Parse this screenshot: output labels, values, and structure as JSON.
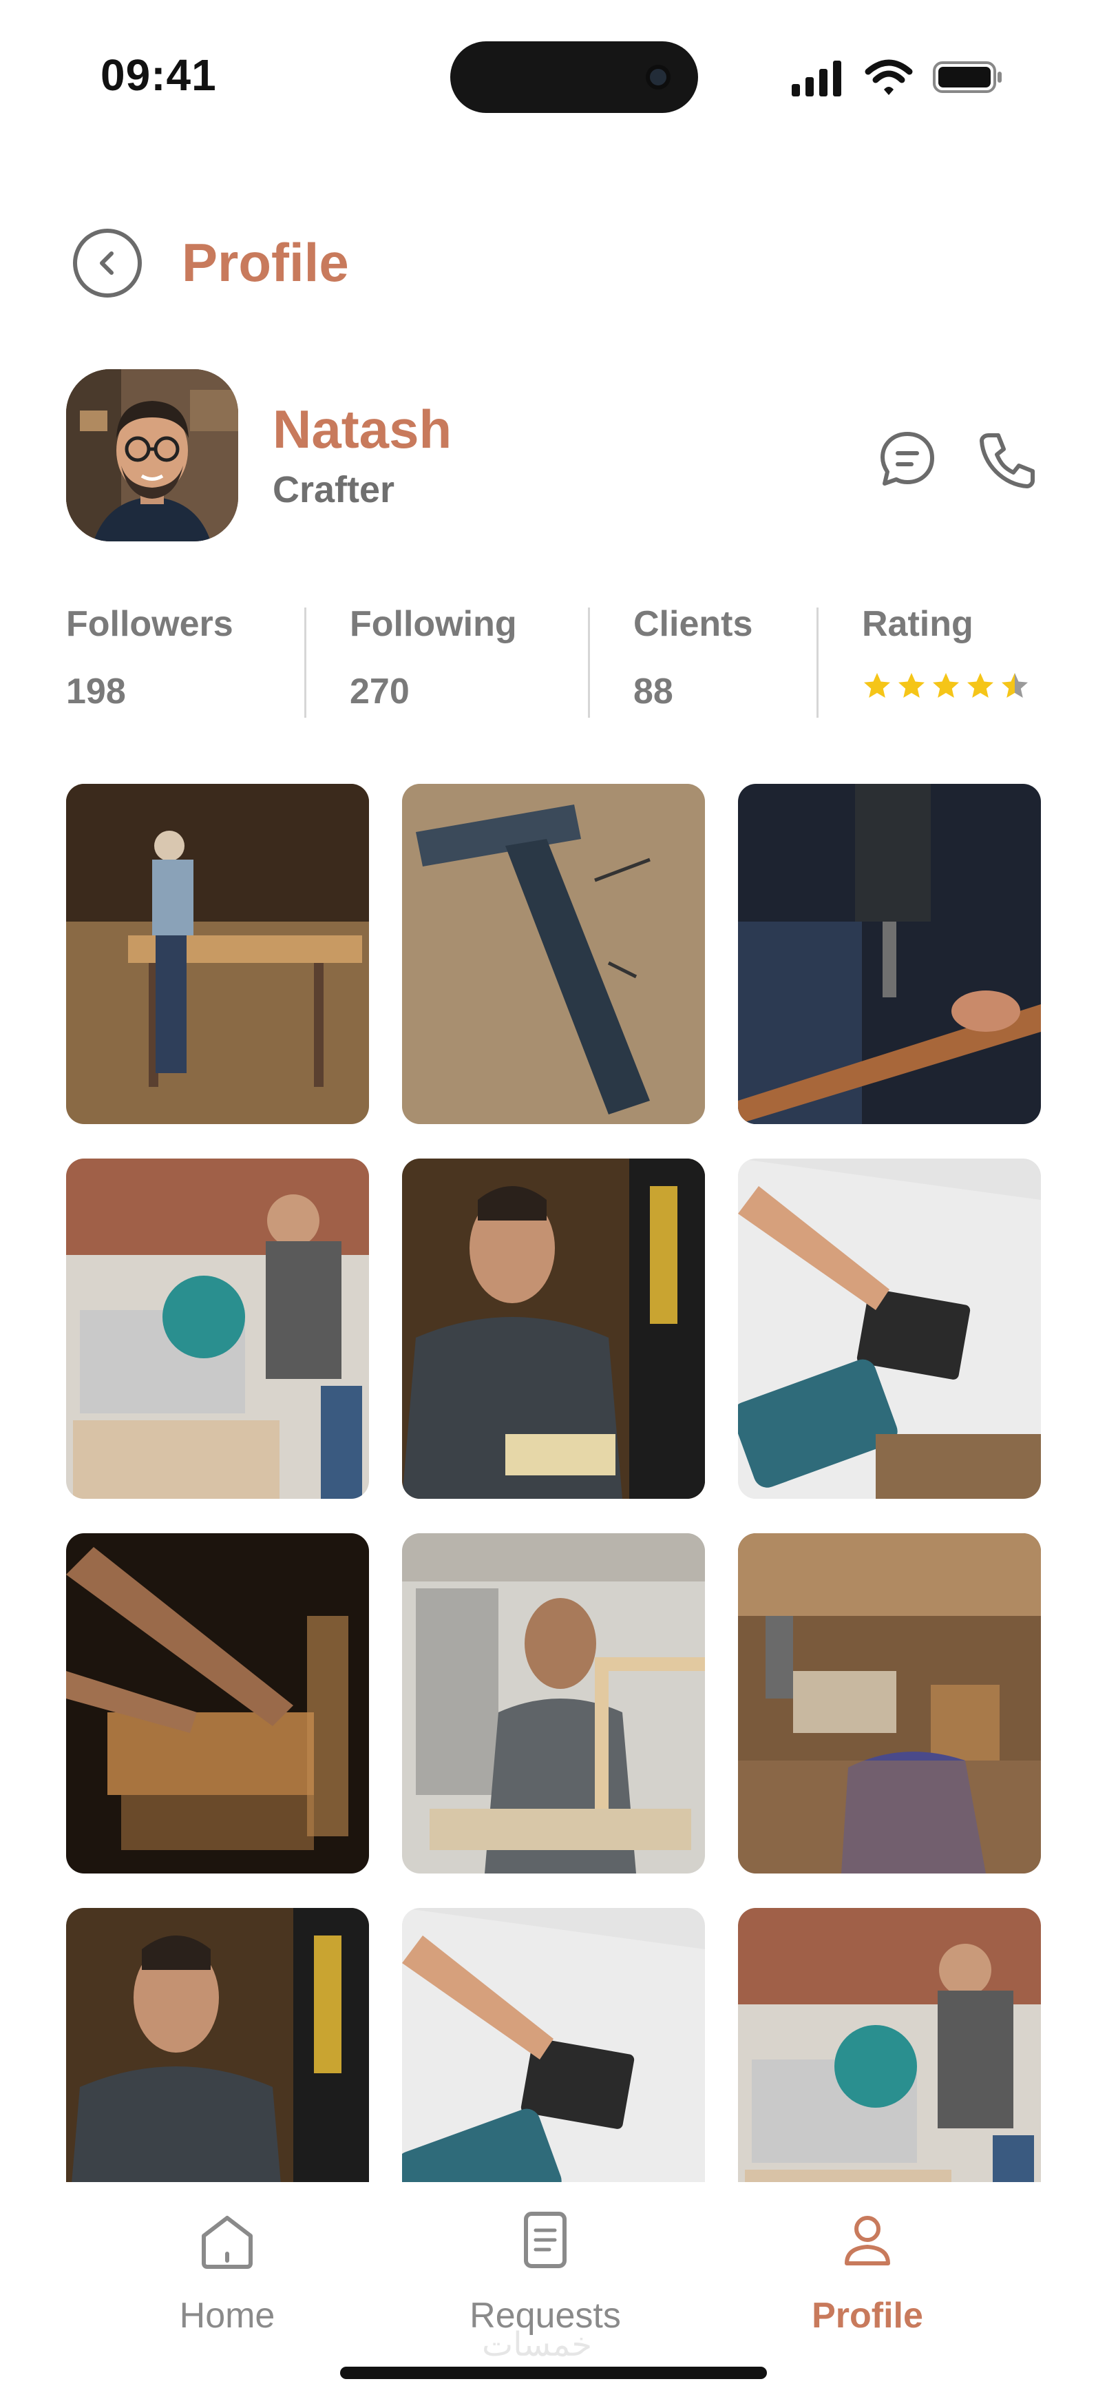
{
  "status_bar": {
    "time": "09:41",
    "icons": [
      "signal-icon",
      "wifi-icon",
      "battery-icon"
    ]
  },
  "header": {
    "title": "Profile",
    "back_icon": "chevron-left-icon"
  },
  "profile": {
    "name": "Natash",
    "role": "Crafter",
    "actions": [
      "chat-icon",
      "phone-icon"
    ]
  },
  "stats": {
    "followers": {
      "label": "Followers",
      "value": "198"
    },
    "following": {
      "label": "Following",
      "value": "270"
    },
    "clients": {
      "label": "Clients",
      "value": "88"
    },
    "rating": {
      "label": "Rating",
      "stars_filled": 4.5,
      "stars_total": 5
    }
  },
  "gallery": {
    "photos": [
      "carpenter-workbench-photo",
      "hammer-on-wood-photo",
      "drill-on-wood-photo",
      "miter-saw-photo",
      "bandsaw-worker-photo",
      "drill-hinge-photo",
      "hands-planing-wood-photo",
      "elder-carpenter-photo",
      "workshop-photo",
      "bandsaw-worker-photo",
      "drill-hinge-photo",
      "miter-saw-photo"
    ]
  },
  "tabbar": {
    "items": [
      {
        "label": "Home",
        "icon": "home-icon"
      },
      {
        "label": "Requests",
        "icon": "document-icon"
      },
      {
        "label": "Profile",
        "icon": "user-icon"
      }
    ],
    "active": "Profile"
  },
  "watermark": "خمسات",
  "colors": {
    "accent": "#c87a5c",
    "muted": "#7a7a7a",
    "star": "#f5c518"
  }
}
